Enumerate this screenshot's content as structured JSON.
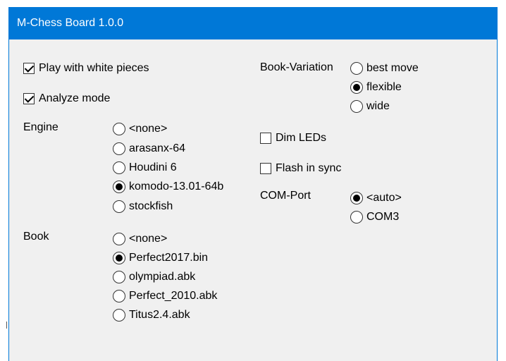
{
  "window": {
    "title": "M-Chess Board 1.0.0"
  },
  "options": {
    "play_white": {
      "label": "Play with white pieces",
      "checked": true
    },
    "analyze": {
      "label": "Analyze mode",
      "checked": true
    },
    "dim_leds": {
      "label": "Dim LEDs",
      "checked": false
    },
    "flash_sync": {
      "label": "Flash in sync",
      "checked": false
    }
  },
  "engine": {
    "label": "Engine",
    "items": [
      "<none>",
      "arasanx-64",
      "Houdini 6",
      "komodo-13.01-64b",
      "stockfish"
    ],
    "selected": "komodo-13.01-64b"
  },
  "book": {
    "label": "Book",
    "items": [
      "<none>",
      "Perfect2017.bin",
      "olympiad.abk",
      "Perfect_2010.abk",
      "Titus2.4.abk"
    ],
    "selected": "Perfect2017.bin"
  },
  "book_variation": {
    "label": "Book-Variation",
    "items": [
      "best move",
      "flexible",
      "wide"
    ],
    "selected": "flexible"
  },
  "com_port": {
    "label": "COM-Port",
    "items": [
      "<auto>",
      "COM3"
    ],
    "selected": "<auto>"
  }
}
